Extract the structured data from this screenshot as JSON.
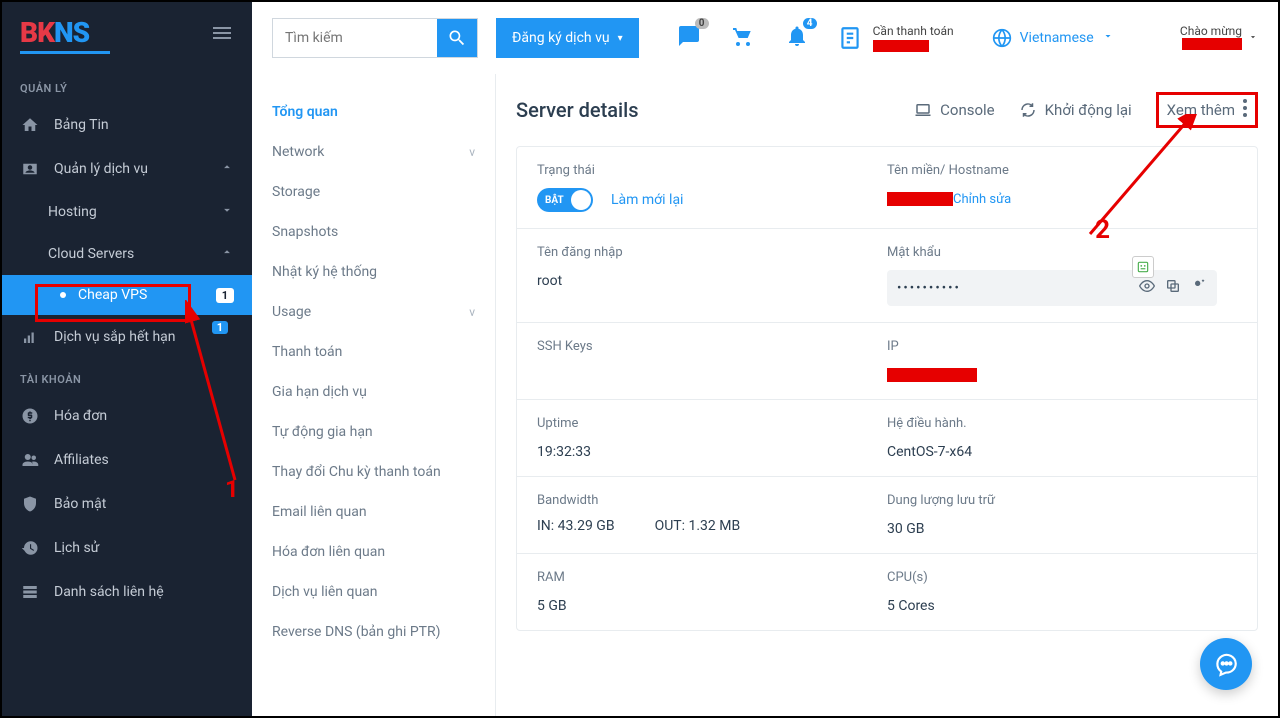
{
  "logo": {
    "part1": "BK",
    "part2": "NS"
  },
  "search": {
    "placeholder": "Tìm kiếm"
  },
  "register_label": "Đăng ký dịch vụ",
  "topbar": {
    "chat_count": "0",
    "notif_count": "4",
    "payment_label": "Cần thanh toán",
    "language": "Vietnamese",
    "welcome": "Chào mừng"
  },
  "sidebar": {
    "section1": "QUẢN LÝ",
    "bangtin": "Bảng Tin",
    "quanly": "Quản lý dịch vụ",
    "hosting": "Hosting",
    "cloud": "Cloud Servers",
    "cheapvps": "Cheap VPS",
    "cheapvps_badge": "1",
    "expiring": "Dịch vụ sắp hết hạn",
    "expiring_badge": "1",
    "section2": "TÀI KHOẢN",
    "hoadon": "Hóa đơn",
    "affiliates": "Affiliates",
    "baomat": "Bảo mật",
    "lichsu": "Lịch sử",
    "lienhe": "Danh sách liên hệ"
  },
  "subnav": {
    "tongquan": "Tổng quan",
    "network": "Network",
    "storage": "Storage",
    "snapshots": "Snapshots",
    "nhatky": "Nhật ký hệ thống",
    "usage": "Usage",
    "thanhtoan": "Thanh toán",
    "giahan": "Gia hạn dịch vụ",
    "tudong": "Tự động gia hạn",
    "thaydoi": "Thay đổi Chu kỳ thanh toán",
    "email": "Email liên quan",
    "hoadonlq": "Hóa đơn liên quan",
    "dichvulq": "Dịch vụ liên quan",
    "reversedns": "Reverse DNS (bản ghi PTR)"
  },
  "details": {
    "title": "Server details",
    "action_console": "Console",
    "action_restart": "Khởi động lại",
    "action_more": "Xem thêm",
    "status_label": "Trạng thái",
    "toggle_on": "BẬT",
    "refresh": "Làm mới lại",
    "hostname_label": "Tên miền/ Hostname",
    "edit": "Chỉnh sửa",
    "login_label": "Tên đăng nhập",
    "login_value": "root",
    "password_label": "Mật khẩu",
    "password_mask": "••••••••••",
    "ssh_label": "SSH Keys",
    "ip_label": "IP",
    "uptime_label": "Uptime",
    "uptime_value": "19:32:33",
    "os_label": "Hệ điều hành.",
    "os_value": "CentOS-7-x64",
    "bandwidth_label": "Bandwidth",
    "bw_in": "IN: 43.29 GB",
    "bw_out": "OUT: 1.32 MB",
    "storage_label": "Dung lượng lưu trữ",
    "storage_value": "30 GB",
    "ram_label": "RAM",
    "ram_value": "5 GB",
    "cpu_label": "CPU(s)",
    "cpu_value": "5 Cores"
  },
  "annotations": {
    "one": "1",
    "two": "2"
  }
}
